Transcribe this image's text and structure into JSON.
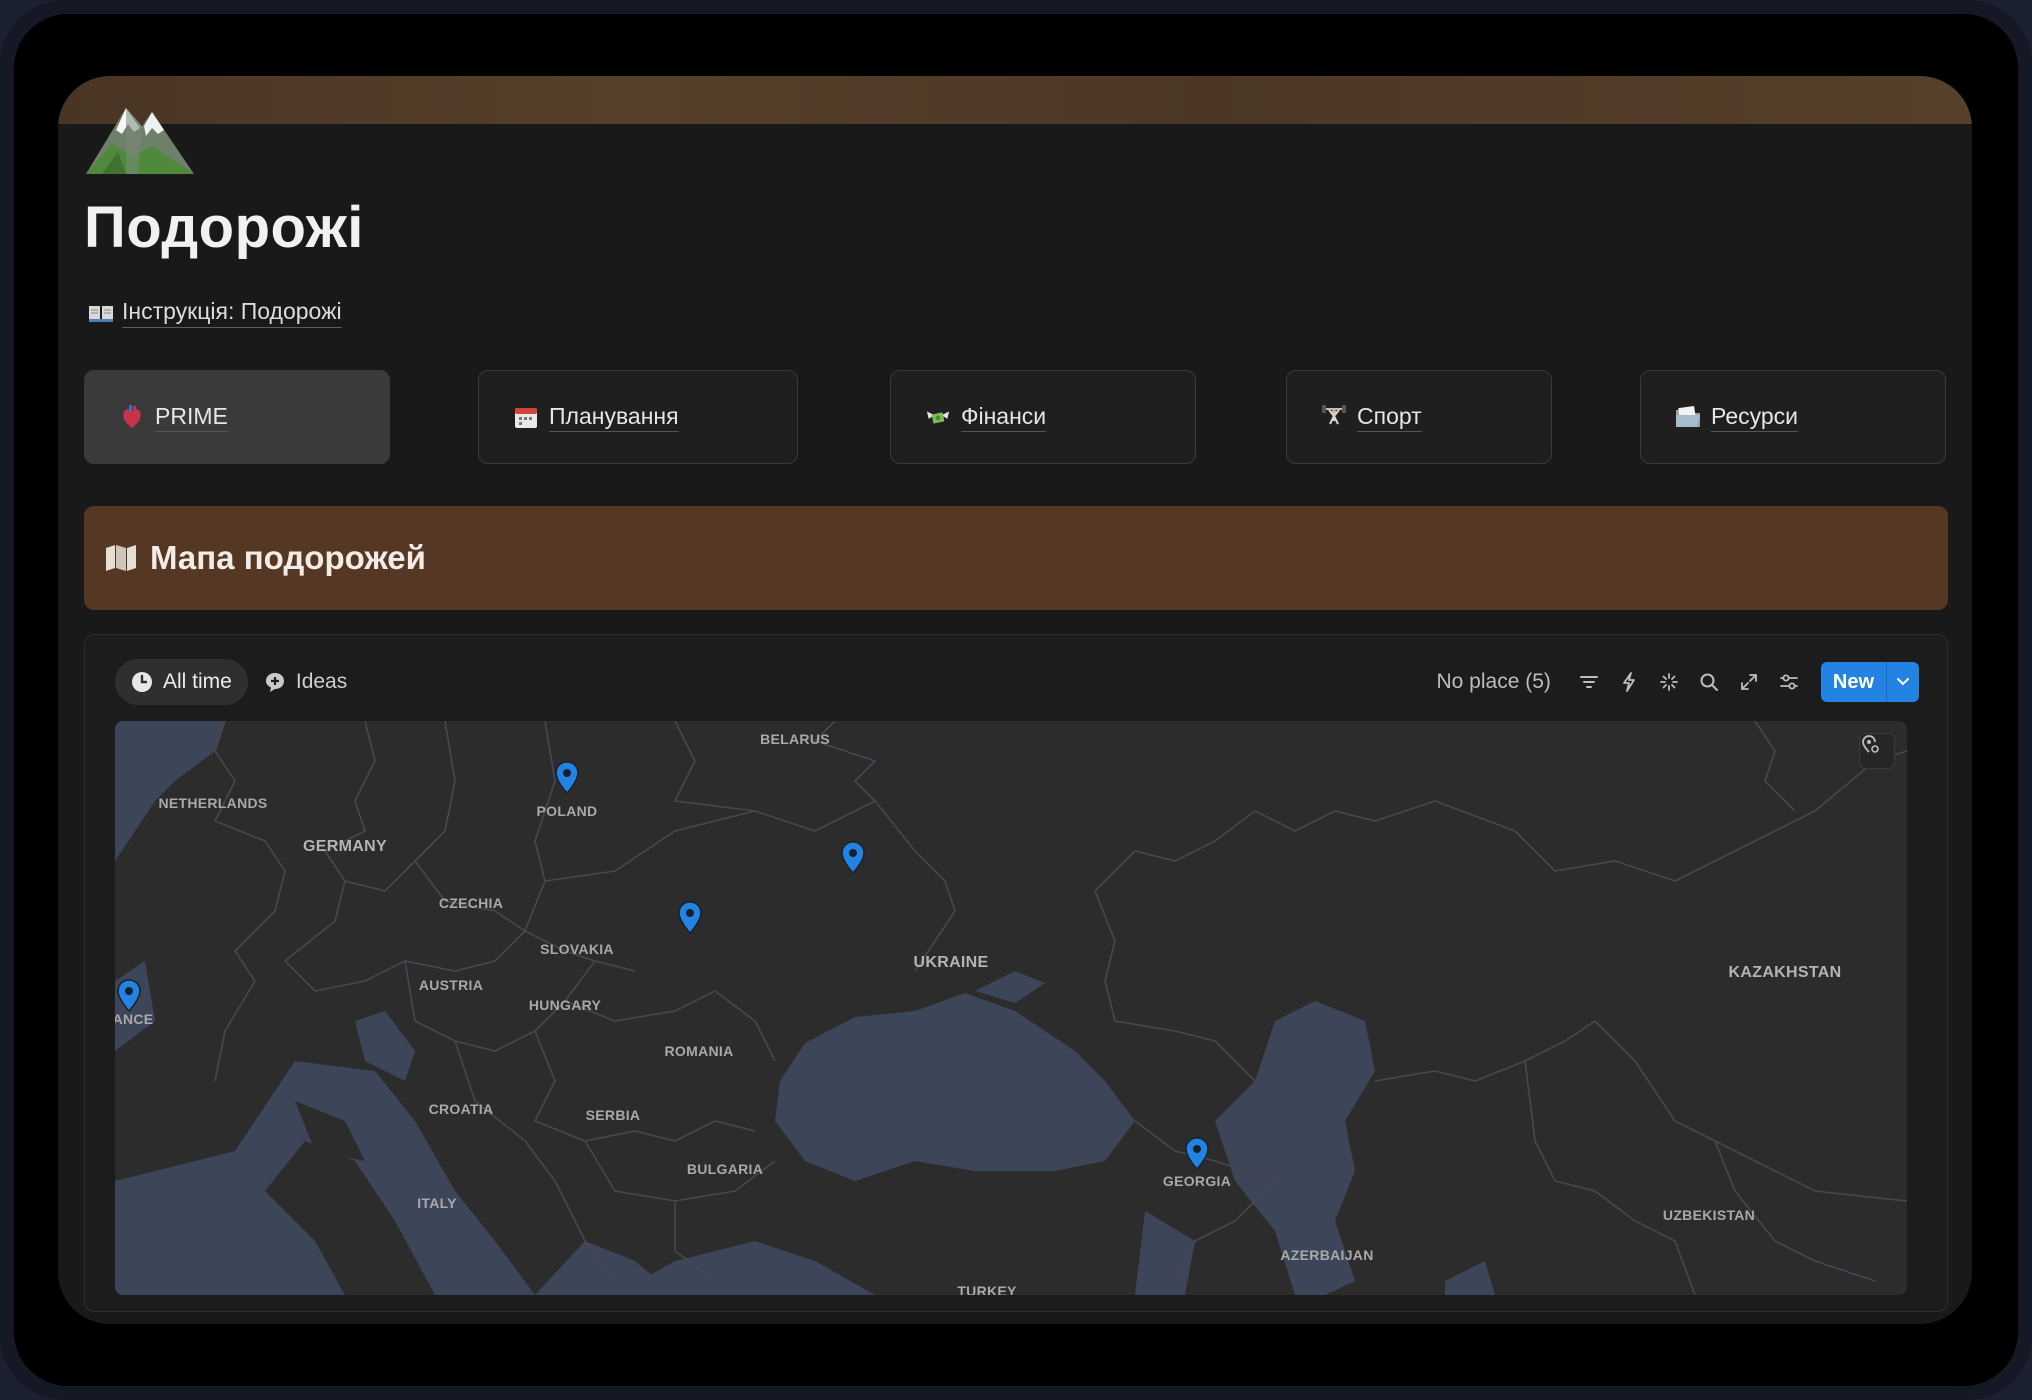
{
  "page": {
    "title": "Подорожі",
    "instruction_link": "Інструкція: Подорожі",
    "icon": "mountain-icon"
  },
  "nav": [
    {
      "label": "PRIME",
      "icon": "anatomical-heart-icon",
      "active": true
    },
    {
      "label": "Планування",
      "icon": "calendar-icon",
      "active": false
    },
    {
      "label": "Фінанси",
      "icon": "money-wings-icon",
      "active": false
    },
    {
      "label": "Спорт",
      "icon": "weightlifter-icon",
      "active": false
    },
    {
      "label": "Ресурси",
      "icon": "folder-icon",
      "active": false
    }
  ],
  "banner": {
    "title": "Мапа подорожей",
    "icon": "world-map-icon"
  },
  "database": {
    "views": [
      {
        "label": "All time",
        "icon": "clock-icon",
        "active": true
      },
      {
        "label": "Ideas",
        "icon": "thought-bubble-icon",
        "active": false
      }
    ],
    "no_place": "No place (5)",
    "new_label": "New",
    "accent": "#2383e2"
  },
  "map": {
    "labels": {
      "netherlands": "NETHERLANDS",
      "germany": "GERMANY",
      "poland": "POLAND",
      "belarus": "BELARUS",
      "czechia": "CZECHIA",
      "slovakia": "SLOVAKIA",
      "austria": "AUSTRIA",
      "hungary": "HUNGARY",
      "ukraine": "UKRAINE",
      "kazakhstan": "KAZAKHSTAN",
      "france": "ANCE",
      "romania": "ROMANIA",
      "croatia": "CROATIA",
      "serbia": "SERBIA",
      "bulgaria": "BULGARIA",
      "italy": "ITALY",
      "georgia": "GEORGIA",
      "uzbekistan": "UZBEKISTAN",
      "azerbaijan": "AZERBAIJAN",
      "turkey": "TURKEY"
    },
    "pin_color": "#2383e2",
    "pin_count": 5
  }
}
